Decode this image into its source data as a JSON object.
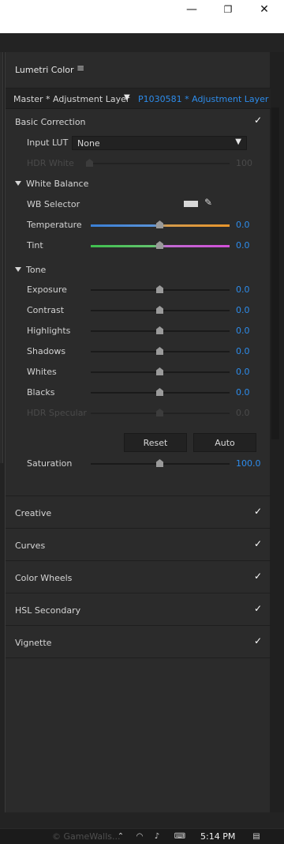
{
  "window": {
    "minimize": "—",
    "restore": "❐",
    "close": "✕"
  },
  "panel": {
    "title": "Lumetri Color",
    "menu_icon": "≡"
  },
  "layer": {
    "master": "Master * Adjustment Layer",
    "clip": "P1030581 * Adjustment Layer"
  },
  "basic": {
    "title": "Basic Correction",
    "input_lut": {
      "label": "Input LUT",
      "value": "None"
    },
    "hdr_white": {
      "label": "HDR White",
      "value": "100"
    },
    "white_balance": {
      "title": "White Balance",
      "wb_selector": "WB Selector",
      "temperature": {
        "label": "Temperature",
        "value": "0.0"
      },
      "tint": {
        "label": "Tint",
        "value": "0.0"
      }
    },
    "tone": {
      "title": "Tone",
      "sliders": [
        {
          "label": "Exposure",
          "value": "0.0"
        },
        {
          "label": "Contrast",
          "value": "0.0"
        },
        {
          "label": "Highlights",
          "value": "0.0"
        },
        {
          "label": "Shadows",
          "value": "0.0"
        },
        {
          "label": "Whites",
          "value": "0.0"
        },
        {
          "label": "Blacks",
          "value": "0.0"
        },
        {
          "label": "HDR Specular",
          "value": "0.0"
        }
      ],
      "reset": "Reset",
      "auto": "Auto"
    },
    "saturation": {
      "label": "Saturation",
      "value": "100.0"
    }
  },
  "sections": [
    "Creative",
    "Curves",
    "Color Wheels",
    "HSL Secondary",
    "Vignette"
  ],
  "check_glyph": "✓",
  "taskbar": {
    "time": "5:14 PM",
    "watermark": "© GameWalls..."
  },
  "colors": {
    "accent": "#2d8ceb",
    "panel_bg": "#2b2b2b"
  }
}
